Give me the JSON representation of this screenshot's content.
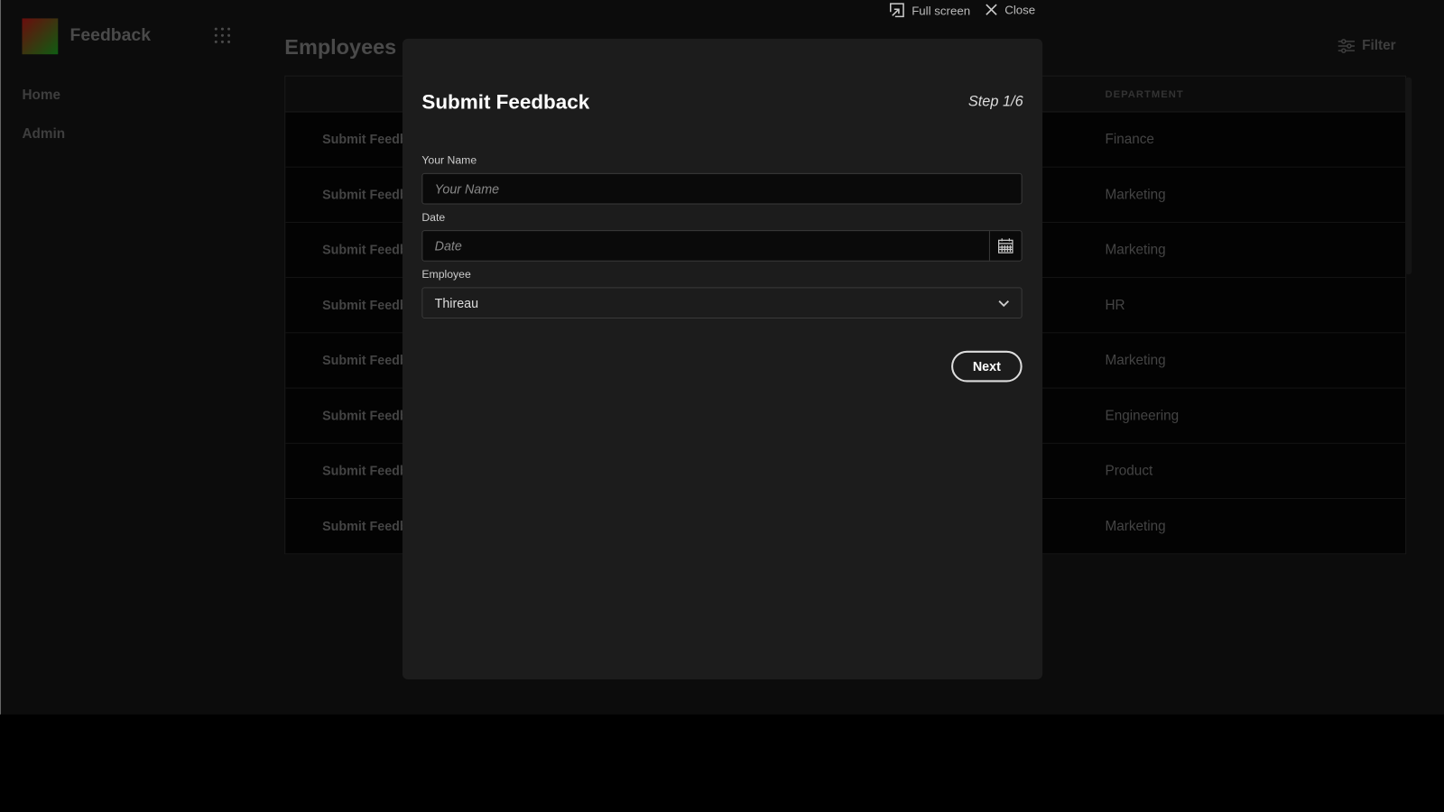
{
  "app": {
    "title": "Feedback",
    "nav": [
      "Home",
      "Admin"
    ]
  },
  "page": {
    "title": "Employees",
    "filter_label": "Filter"
  },
  "table": {
    "column_header": "DEPARTMENT",
    "rows": [
      {
        "action": "Submit Feedback",
        "department": "Finance"
      },
      {
        "action": "Submit Feedback",
        "department": "Marketing"
      },
      {
        "action": "Submit Feedback",
        "department": "Marketing"
      },
      {
        "action": "Submit Feedback",
        "department": "HR"
      },
      {
        "action": "Submit Feedback",
        "department": "Marketing"
      },
      {
        "action": "Submit Feedback",
        "department": "Engineering"
      },
      {
        "action": "Submit Feedback",
        "department": "Product"
      },
      {
        "action": "Submit Feedback",
        "department": "Marketing"
      }
    ]
  },
  "topbar": {
    "fullscreen": "Full screen",
    "close": "Close"
  },
  "modal": {
    "title": "Submit Feedback",
    "step": "Step 1/6",
    "name_label": "Your Name",
    "name_placeholder": "Your Name",
    "name_value": "",
    "date_label": "Date",
    "date_placeholder": "Date",
    "date_value": "",
    "employee_label": "Employee",
    "employee_value": "Thireau",
    "next_label": "Next"
  }
}
